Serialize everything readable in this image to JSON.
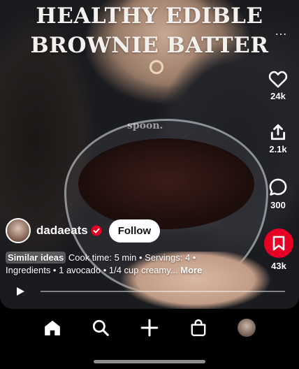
{
  "overlay": {
    "title_line1": "HEALTHY EDIBLE",
    "title_line2": "BROWNIE BATTER",
    "caption_text": "spoon."
  },
  "rail": {
    "like_count": "24k",
    "share_count": "2.1k",
    "comment_count": "300",
    "save_count": "43k"
  },
  "creator": {
    "name": "dadaeats",
    "follow_label": "Follow"
  },
  "description": {
    "tag": "Similar ideas",
    "text": "Cook time: 5 min • Servings: 4 • Ingredients • 1 avocado • 1/4 cup creamy...",
    "more_label": "More"
  },
  "player": {
    "progress": 0.0
  },
  "colors": {
    "save_red": "#e60023"
  }
}
